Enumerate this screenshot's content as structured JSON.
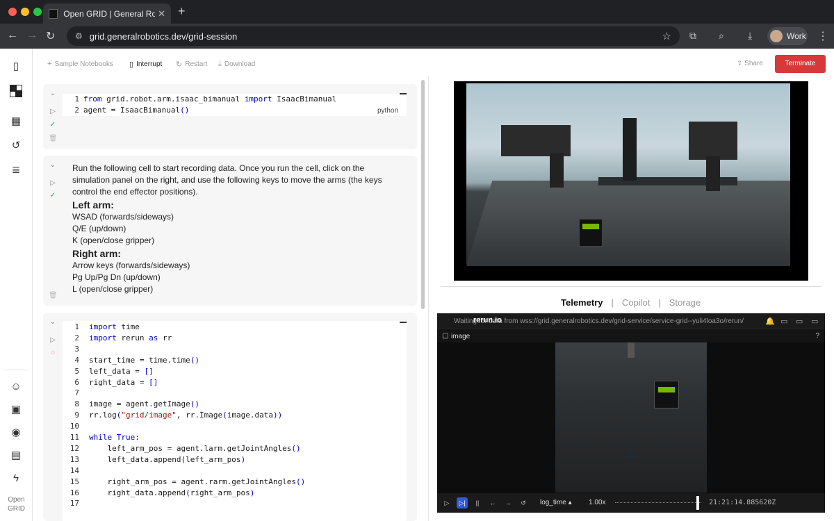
{
  "browser": {
    "tab_title": "Open GRID | General Robotics",
    "url": "grid.generalrobotics.dev/grid-session",
    "profile_label": "Work",
    "colors": {
      "close": "#ff5f57",
      "minimize": "#febc2e",
      "zoom": "#28c840"
    }
  },
  "nav": {
    "brand_line1": "Open",
    "brand_line2": "GRID"
  },
  "toolbar": {
    "sample_notebooks": "Sample Notebooks",
    "interrupt": "Interrupt",
    "restart": "Restart",
    "download": "Download",
    "share": "Share",
    "terminate": "Terminate"
  },
  "cell1": {
    "lines": [
      {
        "n": "1",
        "parts": [
          [
            "kw",
            "from"
          ],
          [
            "",
            " grid.robot.arm.isaac_bimanual "
          ],
          [
            "kw",
            "import"
          ],
          [
            "",
            " IsaacBimanual"
          ]
        ]
      },
      {
        "n": "2",
        "parts": [
          [
            "",
            "agent = IsaacBimanual"
          ],
          [
            "kw",
            "()"
          ]
        ]
      }
    ],
    "language": "python"
  },
  "cell2": {
    "intro": "Run the following cell to start recording data. Once you run the cell, click on the simulation panel on the right, and use the following keys to move the arms (the keys control the end effector positions).",
    "left_heading": "Left arm:",
    "left_items": [
      "WSAD (forwards/sideways)",
      "Q/E (up/down)",
      "K (open/close gripper)"
    ],
    "right_heading": "Right arm:",
    "right_items": [
      "Arrow keys (forwards/sideways)",
      "Pg Up/Pg Dn (up/down)",
      "L (open/close gripper)"
    ]
  },
  "cell3": {
    "lines": [
      {
        "n": "1",
        "parts": [
          [
            "kw",
            "import"
          ],
          [
            "",
            " time"
          ]
        ]
      },
      {
        "n": "2",
        "parts": [
          [
            "kw",
            "import"
          ],
          [
            "",
            " rerun "
          ],
          [
            "kw",
            "as"
          ],
          [
            "",
            " rr"
          ]
        ]
      },
      {
        "n": "3",
        "parts": []
      },
      {
        "n": "4",
        "parts": [
          [
            "",
            "start_time = time.time"
          ],
          [
            "kw",
            "()"
          ]
        ]
      },
      {
        "n": "5",
        "parts": [
          [
            "",
            "left_data = "
          ],
          [
            "kw",
            "[]"
          ]
        ]
      },
      {
        "n": "6",
        "parts": [
          [
            "",
            "right_data = "
          ],
          [
            "kw",
            "[]"
          ]
        ]
      },
      {
        "n": "7",
        "parts": []
      },
      {
        "n": "8",
        "parts": [
          [
            "",
            "image = agent.getImage"
          ],
          [
            "kw",
            "()"
          ]
        ]
      },
      {
        "n": "9",
        "parts": [
          [
            "",
            "rr.log"
          ],
          [
            "kw",
            "("
          ],
          [
            "str",
            "\"grid/image\""
          ],
          [
            "",
            ", rr.Image"
          ],
          [
            "kw",
            "("
          ],
          [
            "",
            "image.data"
          ],
          [
            "kw",
            "))"
          ]
        ]
      },
      {
        "n": "10",
        "parts": []
      },
      {
        "n": "11",
        "parts": [
          [
            "kw",
            "while"
          ],
          [
            "",
            " "
          ],
          [
            "kw",
            "True"
          ],
          [
            "",
            ":"
          ]
        ]
      },
      {
        "n": "12",
        "parts": [
          [
            "",
            "    left_arm_pos = agent.larm.getJointAngles"
          ],
          [
            "kw",
            "()"
          ]
        ]
      },
      {
        "n": "13",
        "parts": [
          [
            "",
            "    left_data.append"
          ],
          [
            "kw",
            "("
          ],
          [
            "",
            "left_arm_pos"
          ],
          [
            "kw",
            ")"
          ]
        ]
      },
      {
        "n": "14",
        "parts": []
      },
      {
        "n": "15",
        "parts": [
          [
            "",
            "    right_arm_pos = agent.rarm.getJointAngles"
          ],
          [
            "kw",
            "()"
          ]
        ]
      },
      {
        "n": "16",
        "parts": [
          [
            "",
            "    right_data.append"
          ],
          [
            "kw",
            "("
          ],
          [
            "",
            "right_arm_pos"
          ],
          [
            "kw",
            ")"
          ]
        ]
      },
      {
        "n": "17",
        "parts": []
      }
    ]
  },
  "panel": {
    "tabs": [
      "Telemetry",
      "Copilot",
      "Storage"
    ],
    "active_tab": "Telemetry"
  },
  "rerun": {
    "logo": "rerun.io",
    "status": "Waiting for data from wss://grid.generalrobotics.dev/grid-service/service-grid--yuli4loa3o/rerun/",
    "view_label": "image",
    "help": "?",
    "timeline": "log_time",
    "speed": "1.00x",
    "timestamp": "21:21:14.885620Z",
    "accent": "#2f5bd6"
  }
}
